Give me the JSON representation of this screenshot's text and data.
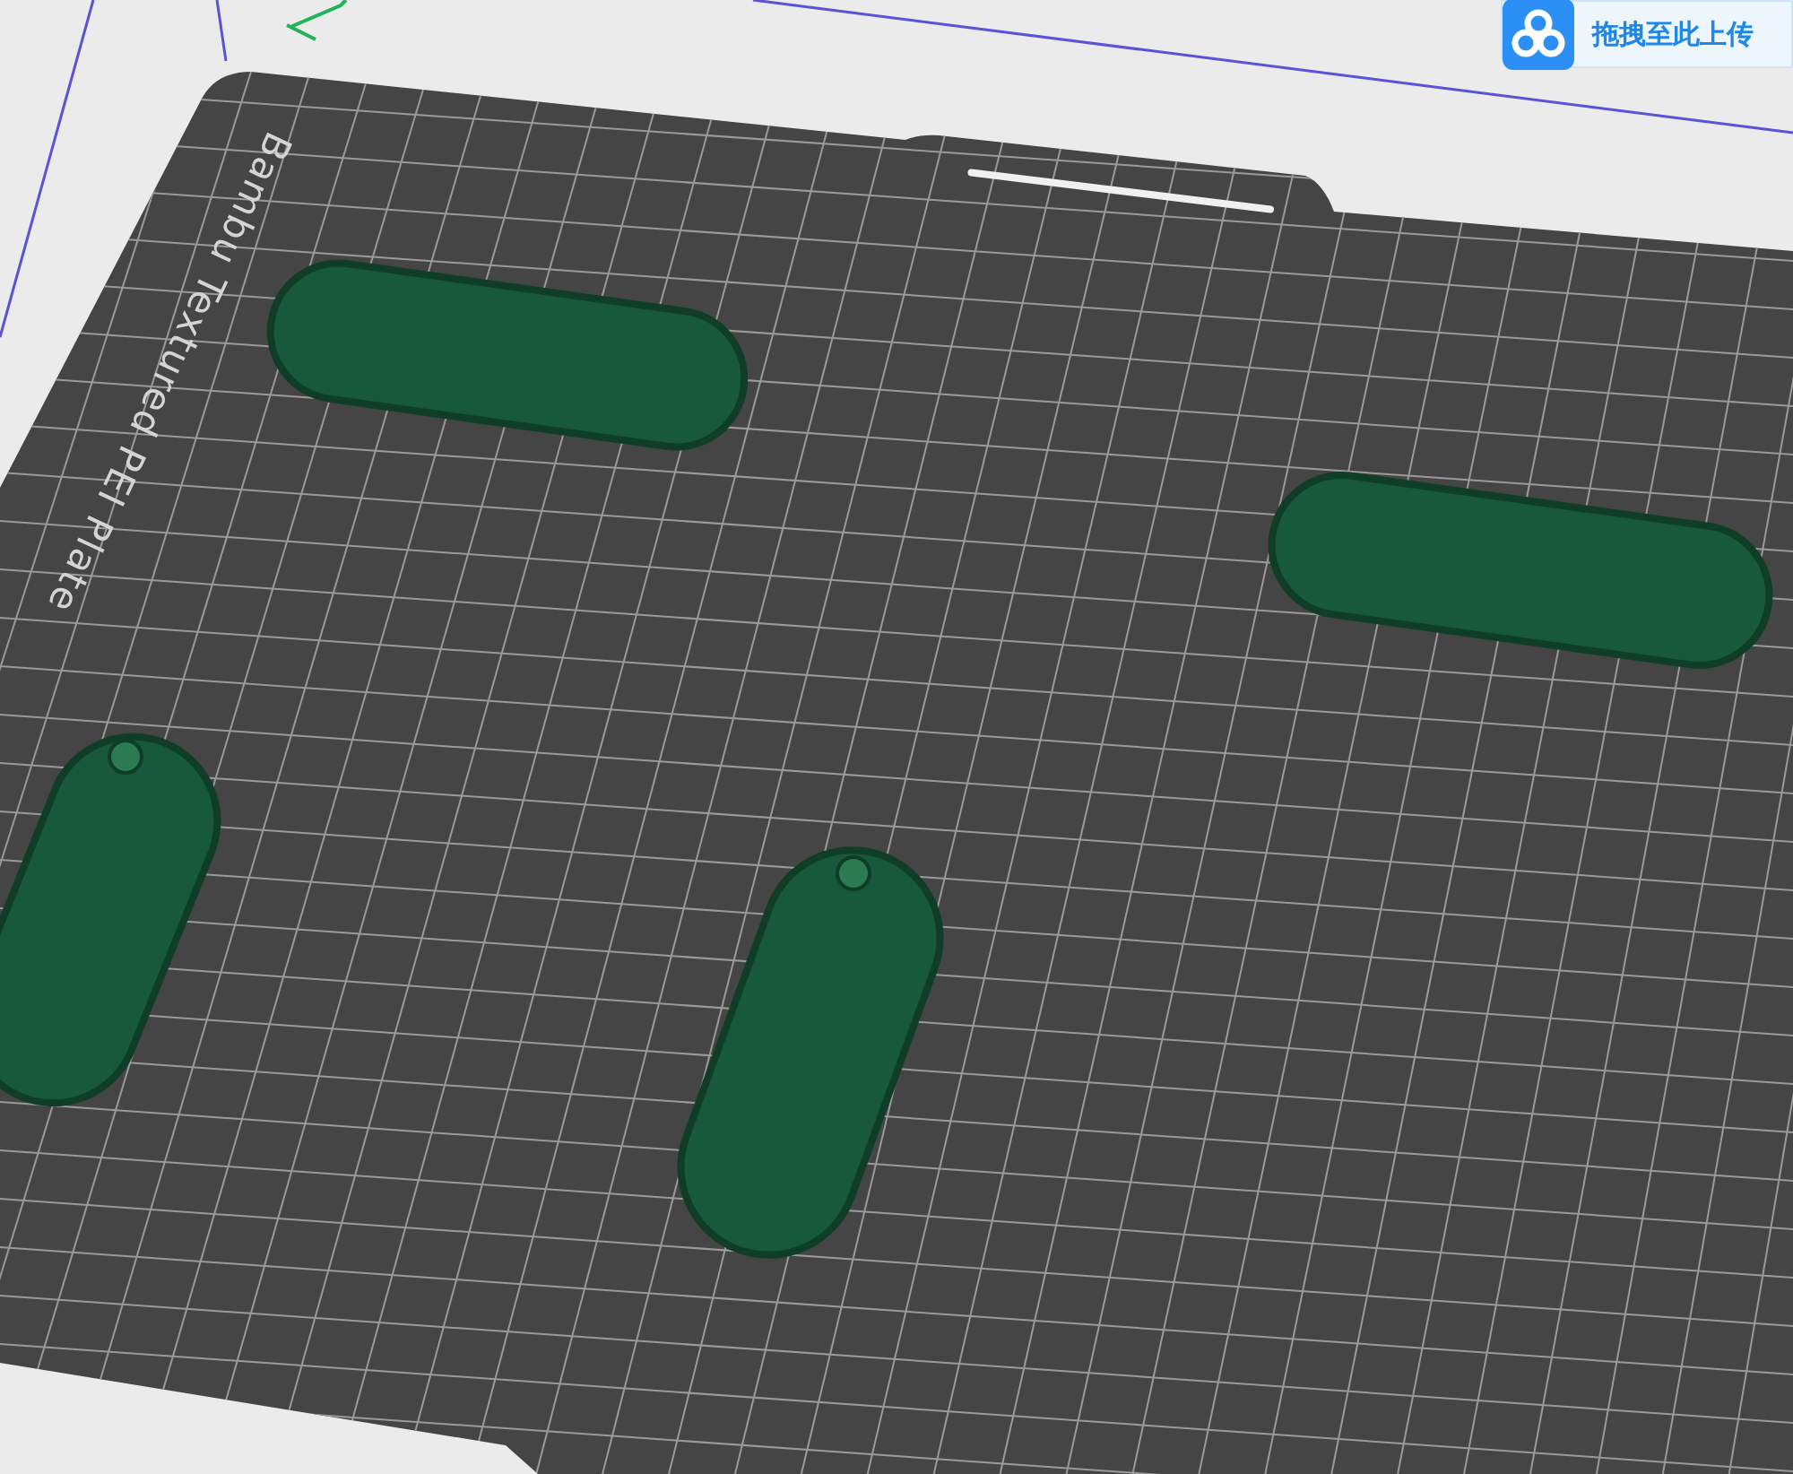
{
  "plate": {
    "label": "Bambu Textured PEI Plate"
  },
  "upload_button": {
    "label": "拖拽至此上传"
  }
}
